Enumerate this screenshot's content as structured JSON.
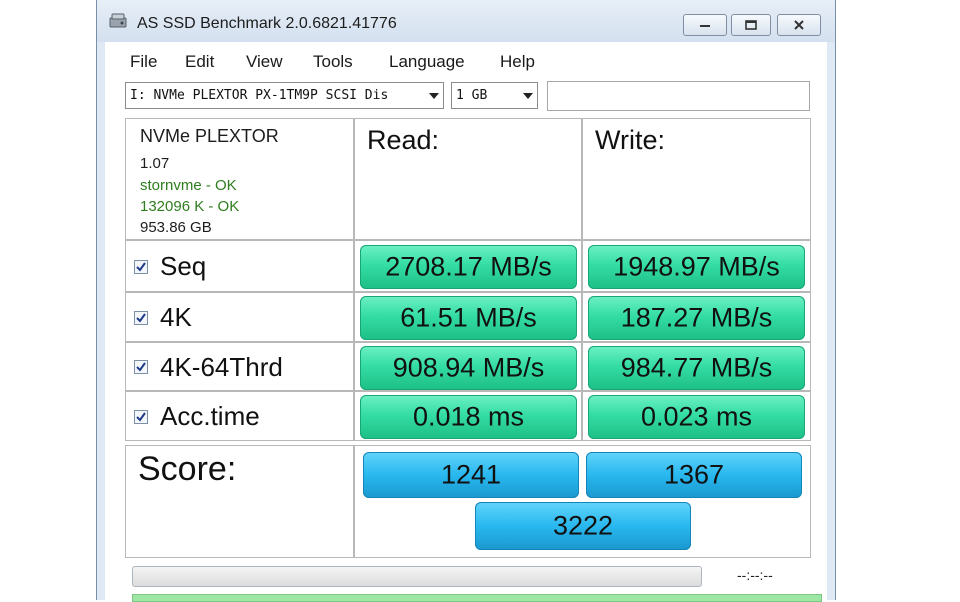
{
  "window": {
    "title": "AS SSD Benchmark 2.0.6821.41776"
  },
  "menu": {
    "items": [
      "File",
      "Edit",
      "View",
      "Tools",
      "Language",
      "Help"
    ]
  },
  "toolbar": {
    "drive_value": "I: NVMe PLEXTOR PX-1TM9P SCSI Dis",
    "size_value": "1 GB",
    "name_field_value": ""
  },
  "drive_info": {
    "name": "NVMe PLEXTOR",
    "firmware": "1.07",
    "driver": "stornvme - OK",
    "alignment": "132096 K - OK",
    "capacity": "953.86 GB"
  },
  "columns": {
    "read": "Read:",
    "write": "Write:"
  },
  "tests": [
    {
      "label": "Seq",
      "checked": true,
      "read": "2708.17 MB/s",
      "write": "1948.97 MB/s"
    },
    {
      "label": "4K",
      "checked": true,
      "read": "61.51 MB/s",
      "write": "187.27 MB/s"
    },
    {
      "label": "4K-64Thrd",
      "checked": true,
      "read": "908.94 MB/s",
      "write": "984.77 MB/s"
    },
    {
      "label": "Acc.time",
      "checked": true,
      "read": "0.018 ms",
      "write": "0.023 ms"
    }
  ],
  "score": {
    "label": "Score:",
    "read": "1241",
    "write": "1367",
    "total": "3222"
  },
  "progress": {
    "value": 0,
    "elapsed": "--:--:--"
  },
  "colors": {
    "result_green": "#34dda4",
    "score_blue": "#28b8ef",
    "ok_text": "#2e7d1e",
    "status_green": "#9ee6a4"
  }
}
